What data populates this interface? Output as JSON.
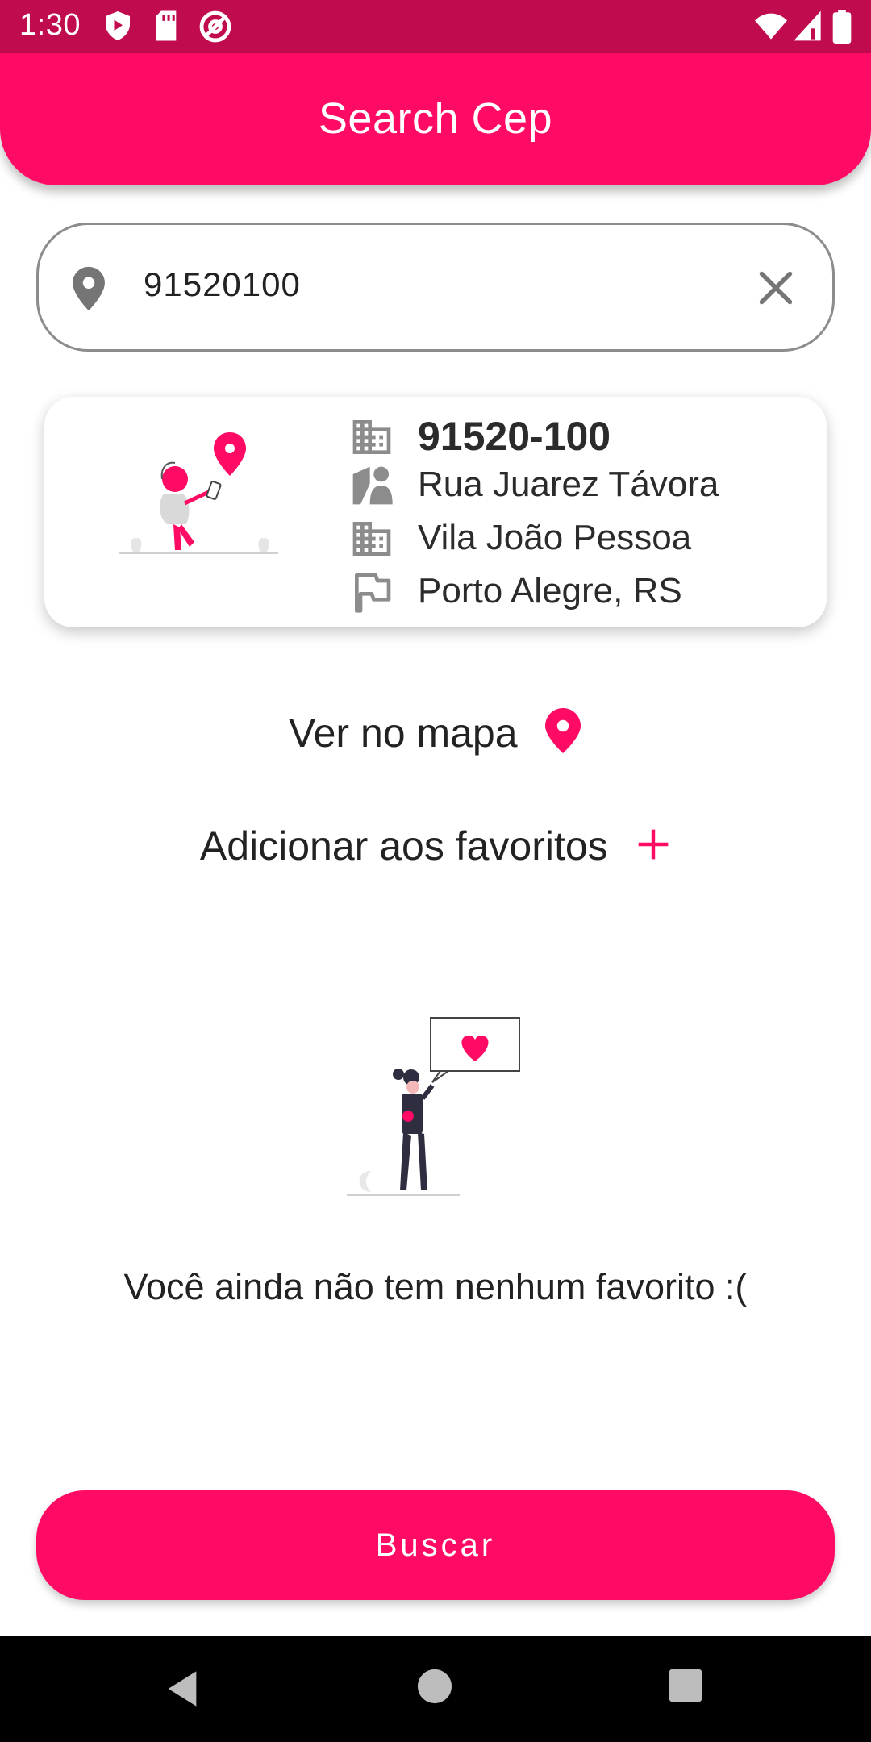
{
  "status_bar": {
    "time": "1:30"
  },
  "app_bar": {
    "title": "Search Cep"
  },
  "search": {
    "value": "91520100",
    "placeholder": ""
  },
  "result": {
    "cep": "91520-100",
    "street": "Rua Juarez Távora",
    "neighborhood": "Vila João Pessoa",
    "city_state": "Porto Alegre, RS"
  },
  "actions": {
    "map_label": "Ver no mapa",
    "favorite_label": "Adicionar aos favoritos"
  },
  "favorites": {
    "empty_message": "Você ainda não tem nenhum favorito :("
  },
  "primary_button": {
    "label": "Buscar"
  },
  "colors": {
    "accent": "#ff0a64",
    "status_bar": "#c00b4e",
    "icon_gray": "#8c8c8c"
  },
  "icons": [
    "shield-icon",
    "sd-card-icon",
    "at-icon",
    "wifi-icon",
    "signal-icon",
    "battery-icon",
    "location-pin-icon",
    "close-icon",
    "building-icon",
    "map-person-icon",
    "flag-icon",
    "plus-icon",
    "back-icon",
    "home-icon",
    "recents-icon"
  ]
}
